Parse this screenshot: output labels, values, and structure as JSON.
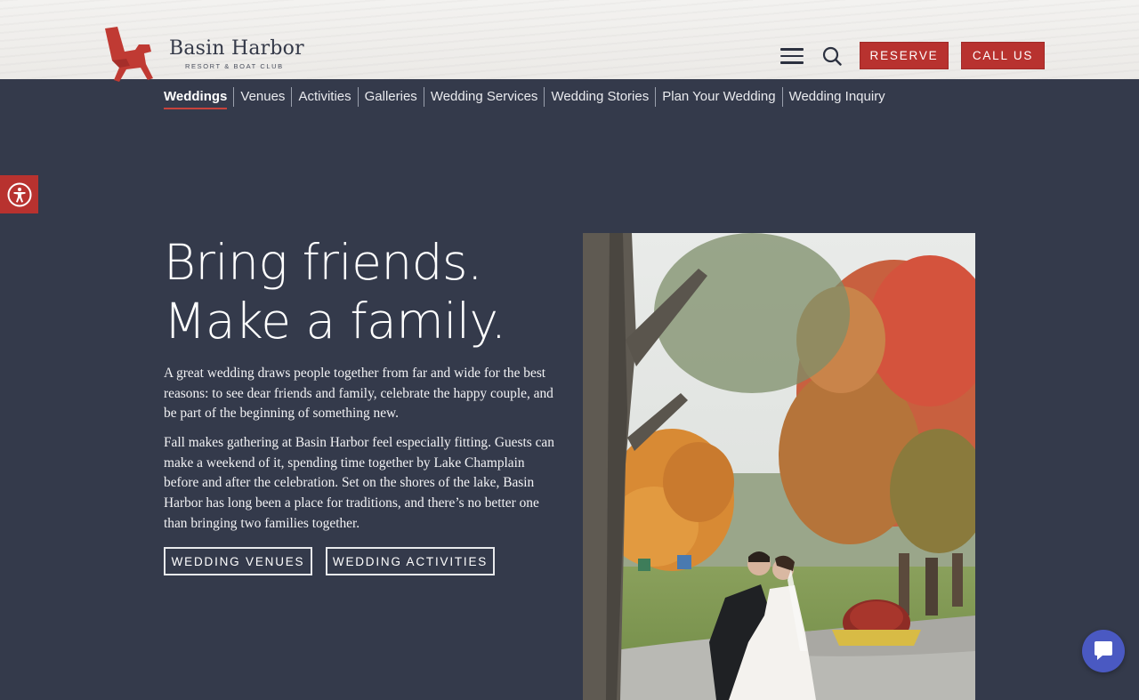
{
  "header": {
    "logo_name": "Basin Harbor",
    "logo_sub": "RESORT & BOAT CLUB",
    "menu_icon": "hamburger-icon",
    "search_icon": "search-icon",
    "reserve_label": "RESERVE",
    "call_label": "CALL US"
  },
  "subnav": {
    "items": [
      "Weddings",
      "Venues",
      "Activities",
      "Galleries",
      "Wedding Services",
      "Wedding Stories",
      "Plan Your Wedding",
      "Wedding Inquiry"
    ],
    "active": "Weddings"
  },
  "accessibility": {
    "icon": "accessibility-icon"
  },
  "hero": {
    "title_line1": "Bring friends.",
    "title_line2": "Make a family.",
    "para1": "A great wedding draws people together from far and wide for the best reasons: to see dear friends and family, celebrate the happy couple, and be part of the beginning of something new.",
    "para2": "Fall makes gathering at Basin Harbor feel especially fitting. Guests can make a weekend of it, spending time together by Lake Champlain before and after the celebration. Set on the shores of the lake, Basin Harbor has long been a place for traditions, and there’s no better one than bringing two families together.",
    "btn_venues": "WEDDING VENUES",
    "btn_activities": "WEDDING ACTIVITIES"
  },
  "chat": {
    "icon": "chat-bubble-icon"
  },
  "colors": {
    "brand_red": "#b8322f",
    "page_bg": "#343a4b",
    "chat_blue": "#4a59c2"
  }
}
